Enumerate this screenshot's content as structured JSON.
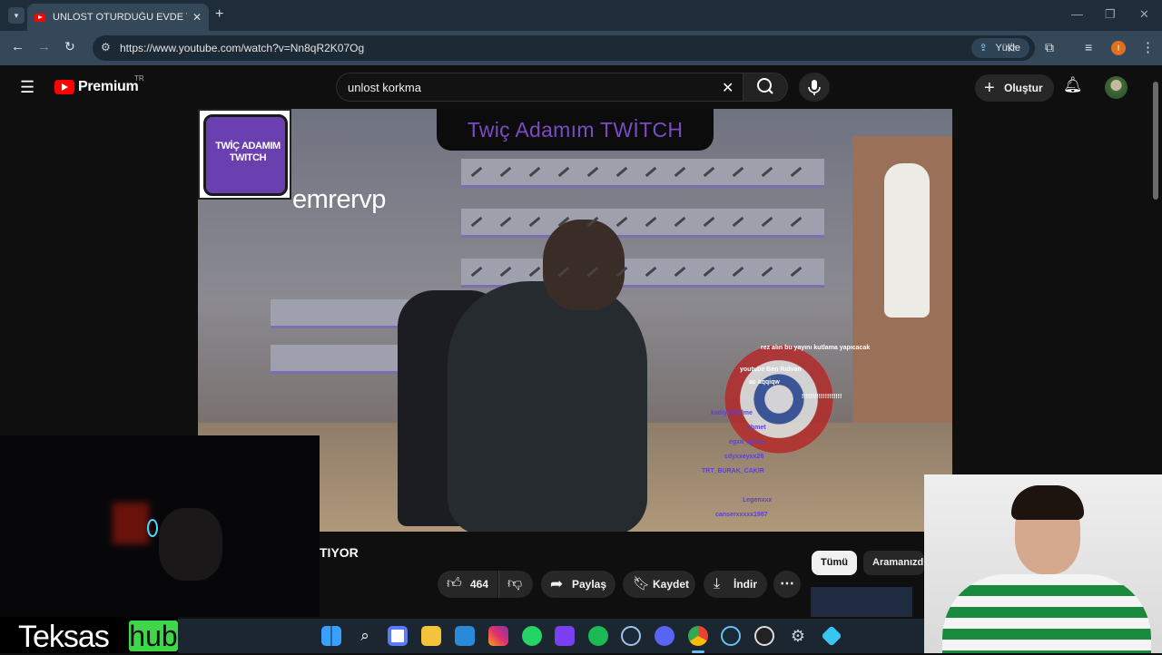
{
  "browser": {
    "tab_title": "UNLOST OTURDUĞU EVDE TOR",
    "url": "https://www.youtube.com/watch?v=Nn8qR2K07Og",
    "yukle_label": "Yükle",
    "profile_initial": "I"
  },
  "youtube": {
    "brand": "Premium",
    "region": "TR",
    "search_query": "unlost korkma",
    "create_label": "Oluştur"
  },
  "video": {
    "badge_text": "TWİÇ ADAMIM TWITCH",
    "banner_text": "Twiç Adamım TWİTCH",
    "streamer_name": "emrervp",
    "chat": [
      {
        "user": "",
        "msg": "rez alın bu yayını kutlama yapıcacak",
        "color": "#ffffff"
      },
      {
        "user": "",
        "msg": "youtube Ben Rıdvan",
        "color": "#ffffff"
      },
      {
        "user": "",
        "msg": "ac aqqiqw",
        "color": "#ffffff"
      },
      {
        "user": "",
        "msg": "!!!!!!!!!!!!!!!!!!!",
        "color": "#ffffff"
      },
      {
        "user": "kadiyukselme",
        "msg": "",
        "color": "#5b3fe0"
      },
      {
        "user": "ahmet",
        "msg": "",
        "color": "#5b3fe0"
      },
      {
        "user": "egxit_ayxm",
        "msg": "",
        "color": "#5b3fe0"
      },
      {
        "user": "cdyxxeyxx28",
        "msg": "",
        "color": "#5b3fe0"
      },
      {
        "user": "TRT_BURAK_CAKIR",
        "msg": "",
        "color": "#5b3fe0"
      },
      {
        "user": "",
        "msg": "",
        "color": "#5b3fe0"
      },
      {
        "user": "Legenxxx",
        "msg": "",
        "color": "#5b3fe0"
      },
      {
        "user": "canserxxxxx1987",
        "msg": "",
        "color": "#5b3fe0"
      }
    ]
  },
  "meta": {
    "title_fragment": "TIYOR",
    "like_count": "464",
    "share_label": "Paylaş",
    "save_label": "Kaydet",
    "download_label": "İndir"
  },
  "chips": [
    "Tümü",
    "Aramanızd"
  ],
  "overlay": {
    "logo_part_a": "Teksas",
    "logo_part_b": "hub"
  },
  "colors": {
    "yt_red": "#ff0000",
    "twitch_purple": "#6a3fb0",
    "chrome_bg": "#1f2d3a",
    "teksas_green": "#3fd64a"
  }
}
